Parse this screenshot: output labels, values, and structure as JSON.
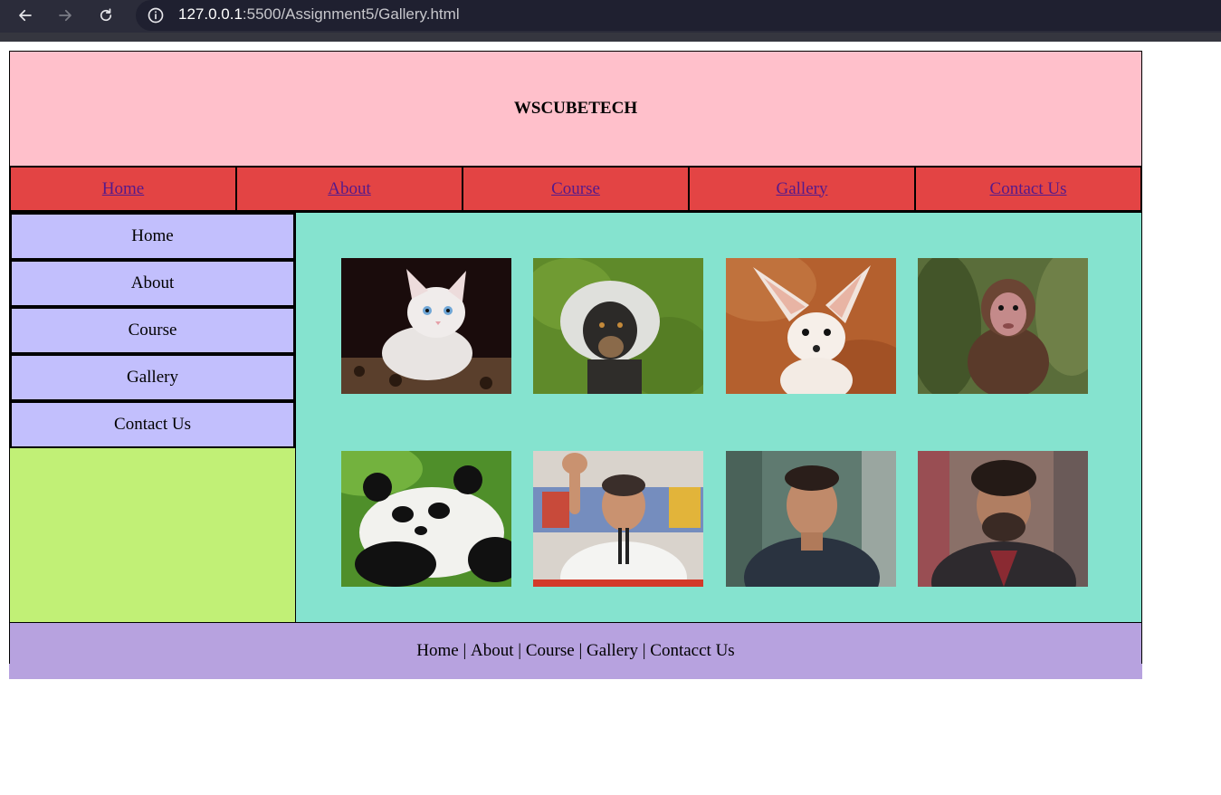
{
  "browser": {
    "url_host": "127.0.0.1",
    "url_path": ":5500/Assignment5/Gallery.html",
    "back_icon": "arrow-left-icon",
    "forward_icon": "arrow-right-icon",
    "reload_icon": "reload-icon",
    "info_icon": "info-icon"
  },
  "header": {
    "title": "WSCUBETECH"
  },
  "topnav": {
    "items": [
      "Home",
      "About",
      "Course",
      "Gallery",
      "Contact Us"
    ]
  },
  "sidebar": {
    "items": [
      "Home",
      "About",
      "Course",
      "Gallery",
      "Contact Us"
    ]
  },
  "gallery": {
    "images": [
      "kitten",
      "colobus-monkey",
      "fennec-fox",
      "baby-macaque",
      "panda",
      "man-waving-at-podium",
      "man-in-dark-tshirt",
      "bearded-man-in-suit"
    ]
  },
  "footer": {
    "links": [
      "Home",
      "About",
      "Course",
      "Gallery",
      "Contacct Us"
    ],
    "separator": "|"
  },
  "colors": {
    "header_bg": "#ffc0cb",
    "topnav_bg": "#e34444",
    "sidebar_item_bg": "#c2bffd",
    "sidebar_bg": "#c1f076",
    "gallery_bg": "#85e3cf",
    "footer_bg": "#b7a2df",
    "link_color": "#551a8b"
  }
}
